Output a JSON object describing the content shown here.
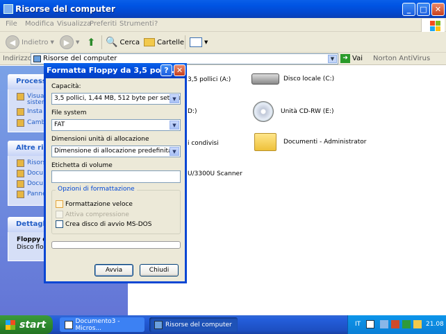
{
  "window": {
    "title": "Risorse del computer",
    "buttons": [
      "_",
      "□",
      "✕"
    ]
  },
  "menu": [
    "File",
    "Modifica",
    "Visualizza",
    "Preferiti",
    "Strumenti",
    "?"
  ],
  "toolbar": {
    "back": "Indietro",
    "search": "Cerca",
    "folders": "Cartelle"
  },
  "address": {
    "label": "Indirizzo",
    "value": "Risorse del computer",
    "go": "Vai",
    "extra": "Norton AntiVirus"
  },
  "left_panels": [
    {
      "title": "Processi",
      "tasks": [
        "Visua",
        "sister",
        "Insta",
        "Camb"
      ]
    },
    {
      "title": "Altre riso",
      "tasks": [
        "Risors",
        "Docu",
        "Docu",
        "Panne"
      ]
    },
    {
      "title": "Dettagli",
      "detail_title": "Floppy d",
      "detail_sub": "Disco flopp"
    }
  ],
  "content": [
    {
      "label": "3,5 pollici (A:)"
    },
    {
      "label": "Disco locale (C:)"
    },
    {
      "label": "D:)"
    },
    {
      "label": "Unità CD-RW (E:)"
    },
    {
      "label": "i condivisi"
    },
    {
      "label": "Documenti - Administrator"
    },
    {
      "label": "U/3300U Scanner"
    }
  ],
  "dialog": {
    "title": "Formatta Floppy da 3,5 polli...",
    "help_btn": "?",
    "close_btn": "✕",
    "capacity_label": "Capacità:",
    "capacity_value": "3,5 pollici, 1,44 MB, 512 byte per settore",
    "fs_label": "File system",
    "fs_value": "FAT",
    "alloc_label": "Dimensioni unità di allocazione",
    "alloc_value": "Dimensione di allocazione predefinita",
    "volume_label": "Etichetta di volume",
    "volume_value": "",
    "options_title": "Opzioni di formattazione",
    "opt_quick": "Formattazione veloce",
    "opt_compress": "Attiva compressione",
    "opt_bootdisk": "Crea disco di avvio MS-DOS",
    "start_btn": "Avvia",
    "close_btn_label": "Chiudi"
  },
  "taskbar": {
    "start": "start",
    "items": [
      "Documento3 - Micros...",
      "Risorse del computer"
    ],
    "lang": "IT",
    "clock": "21.08"
  }
}
